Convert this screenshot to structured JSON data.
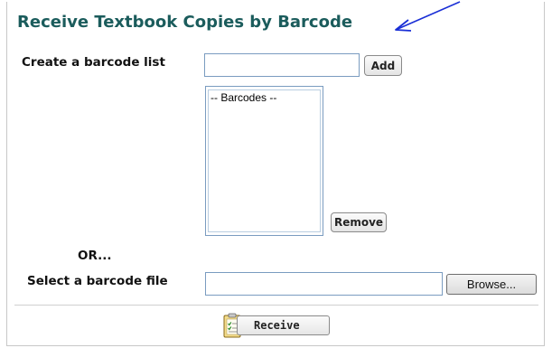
{
  "header": {
    "title": "Receive Textbook Copies by Barcode"
  },
  "barcode_list": {
    "label": "Create a barcode list",
    "input_value": "",
    "add_label": "Add",
    "list_items": [
      "-- Barcodes --"
    ],
    "remove_label": "Remove"
  },
  "separator": {
    "or_label": "OR..."
  },
  "file": {
    "label": "Select a barcode file",
    "input_value": "",
    "browse_label": "Browse..."
  },
  "footer": {
    "receive_label": "Receive"
  },
  "colors": {
    "title": "#1b5c5c",
    "arrow": "#1a2fd6"
  },
  "icons": {
    "arrow": "annotation-arrow-icon",
    "receive": "clipboard-checklist-icon"
  }
}
